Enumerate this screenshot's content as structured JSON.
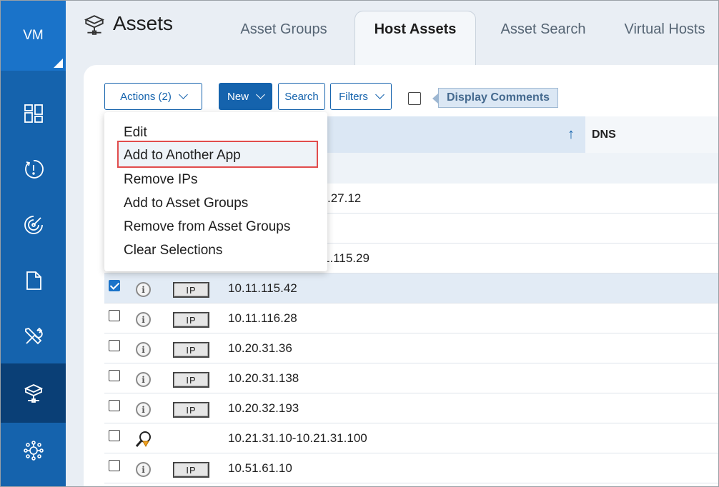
{
  "sidebar": {
    "logo": "VM",
    "items": [
      {
        "icon": "dashboard-icon"
      },
      {
        "icon": "detection-icon"
      },
      {
        "icon": "scan-icon"
      },
      {
        "icon": "report-icon"
      },
      {
        "icon": "tools-icon"
      },
      {
        "icon": "assets-icon",
        "active": true
      },
      {
        "icon": "network-icon"
      }
    ]
  },
  "header": {
    "title": "Assets",
    "tabs": [
      {
        "label": "Asset Groups"
      },
      {
        "label": "Host Assets",
        "active": true
      },
      {
        "label": "Asset Search"
      },
      {
        "label": "Virtual Hosts"
      }
    ]
  },
  "toolbar": {
    "actions_label": "Actions (2)",
    "new_label": "New",
    "search_label": "Search",
    "filters_label": "Filters",
    "display_comments_label": "Display Comments"
  },
  "table": {
    "dns_header": "DNS",
    "rows": [
      {
        "ip": "10.11.115.42",
        "checked": true,
        "type": "IP"
      },
      {
        "ip": "10.11.116.28",
        "checked": false,
        "type": "IP"
      },
      {
        "ip": "10.20.31.36",
        "checked": false,
        "type": "IP"
      },
      {
        "ip": "10.20.31.138",
        "checked": false,
        "type": "IP"
      },
      {
        "ip": "10.20.32.193",
        "checked": false,
        "type": "IP"
      },
      {
        "ip": "10.21.31.10-10.21.31.100",
        "checked": false,
        "type": "range"
      },
      {
        "ip": "10.51.61.10",
        "checked": false,
        "type": "IP"
      }
    ],
    "partial_rows": [
      ".27.12",
      "1.115.29"
    ]
  },
  "actions_menu": {
    "items": [
      "Edit",
      "Add to Another App",
      "Remove IPs",
      "Add to Asset Groups",
      "Remove from Asset Groups",
      "Clear Selections"
    ],
    "highlighted": "Add to Another App"
  },
  "colors": {
    "sidebar": "#1563ad",
    "accent": "#1a73c9",
    "highlight_border": "#e14c4c"
  }
}
